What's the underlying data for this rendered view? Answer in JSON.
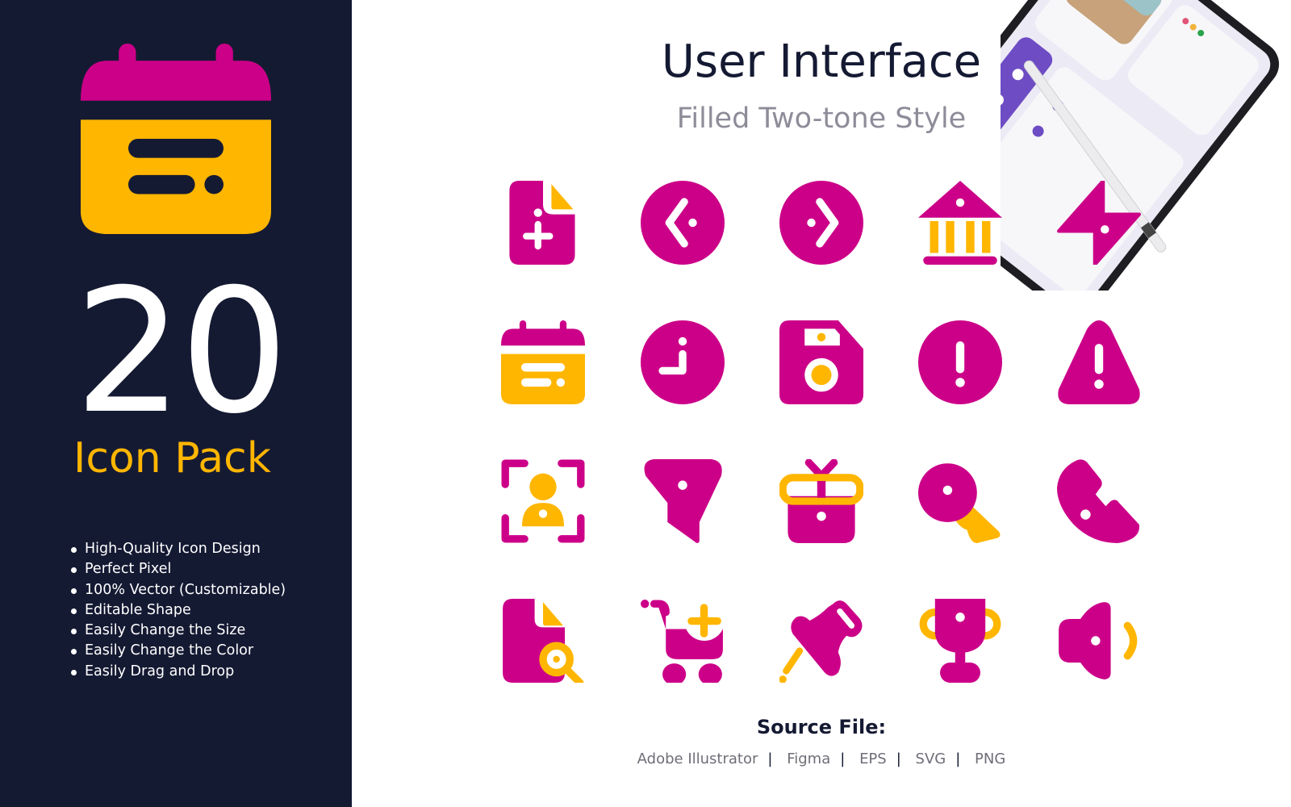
{
  "colors": {
    "primary": "#cc0088",
    "secondary": "#ffb600",
    "panel": "#151a33",
    "text": "#151a33",
    "muted": "#8d8c99"
  },
  "left_panel": {
    "hero_icon": "calendar-icon",
    "count": "20",
    "pack_label": "Icon Pack",
    "features": [
      "High-Quality Icon Design",
      "Perfect Pixel",
      "100% Vector (Customizable)",
      "Editable Shape",
      "Easily Change the Size",
      "Easily Change the Color",
      "Easily Drag and Drop"
    ]
  },
  "header": {
    "title": "User Interface",
    "subtitle": "Filled Two-tone Style"
  },
  "icons": [
    "file-plus-icon",
    "arrow-left-circle-icon",
    "arrow-right-circle-icon",
    "bank-icon",
    "lightning-icon",
    "calendar-icon",
    "clock-icon",
    "save-icon",
    "alert-circle-icon",
    "warning-icon",
    "user-scan-icon",
    "filter-icon",
    "gift-icon",
    "key-icon",
    "phone-icon",
    "file-search-icon",
    "cart-add-icon",
    "pin-icon",
    "trophy-icon",
    "speaker-icon"
  ],
  "source": {
    "label": "Source File:",
    "formats": [
      "Adobe Illustrator",
      "Figma",
      "EPS",
      "SVG",
      "PNG"
    ]
  }
}
